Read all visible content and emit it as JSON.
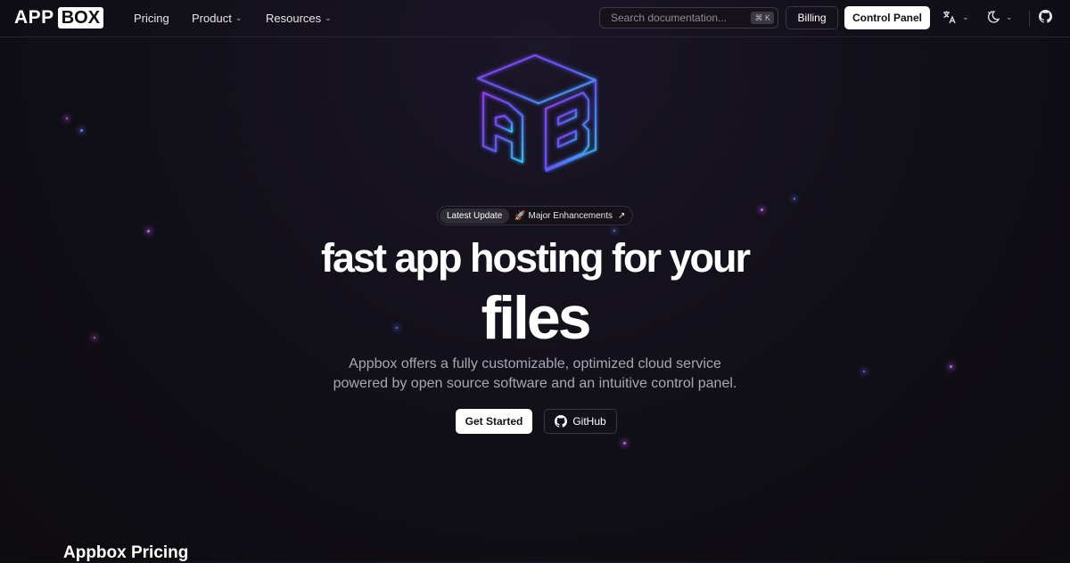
{
  "brand": {
    "app": "APP",
    "box": "BOX"
  },
  "nav": {
    "links": [
      {
        "label": "Pricing"
      },
      {
        "label": "Product"
      },
      {
        "label": "Resources"
      }
    ],
    "search": {
      "placeholder": "Search documentation...",
      "shortcut": "⌘ K"
    },
    "billing_label": "Billing",
    "control_panel_label": "Control Panel",
    "icons": [
      "translate-icon",
      "theme-icon",
      "github-icon"
    ]
  },
  "hero": {
    "logo_letters": "AB",
    "badge": {
      "tag": "Latest Update",
      "text": "🚀 Major Enhancements",
      "arrow": "↗"
    },
    "title_line1": "fast app hosting for your",
    "title_line2": "files",
    "subtitle_line1": "Appbox offers a fully customizable, optimized cloud service",
    "subtitle_line2": "powered by open source software and an intuitive control panel.",
    "cta_primary": "Get Started",
    "cta_secondary": "GitHub"
  },
  "sections": {
    "pricing_title": "Appbox Pricing"
  },
  "colors": {
    "background": "#0d0c10",
    "accent_purple": "#7b3ff2",
    "accent_cyan": "#2fb6f0",
    "star": "#c65cf0"
  }
}
